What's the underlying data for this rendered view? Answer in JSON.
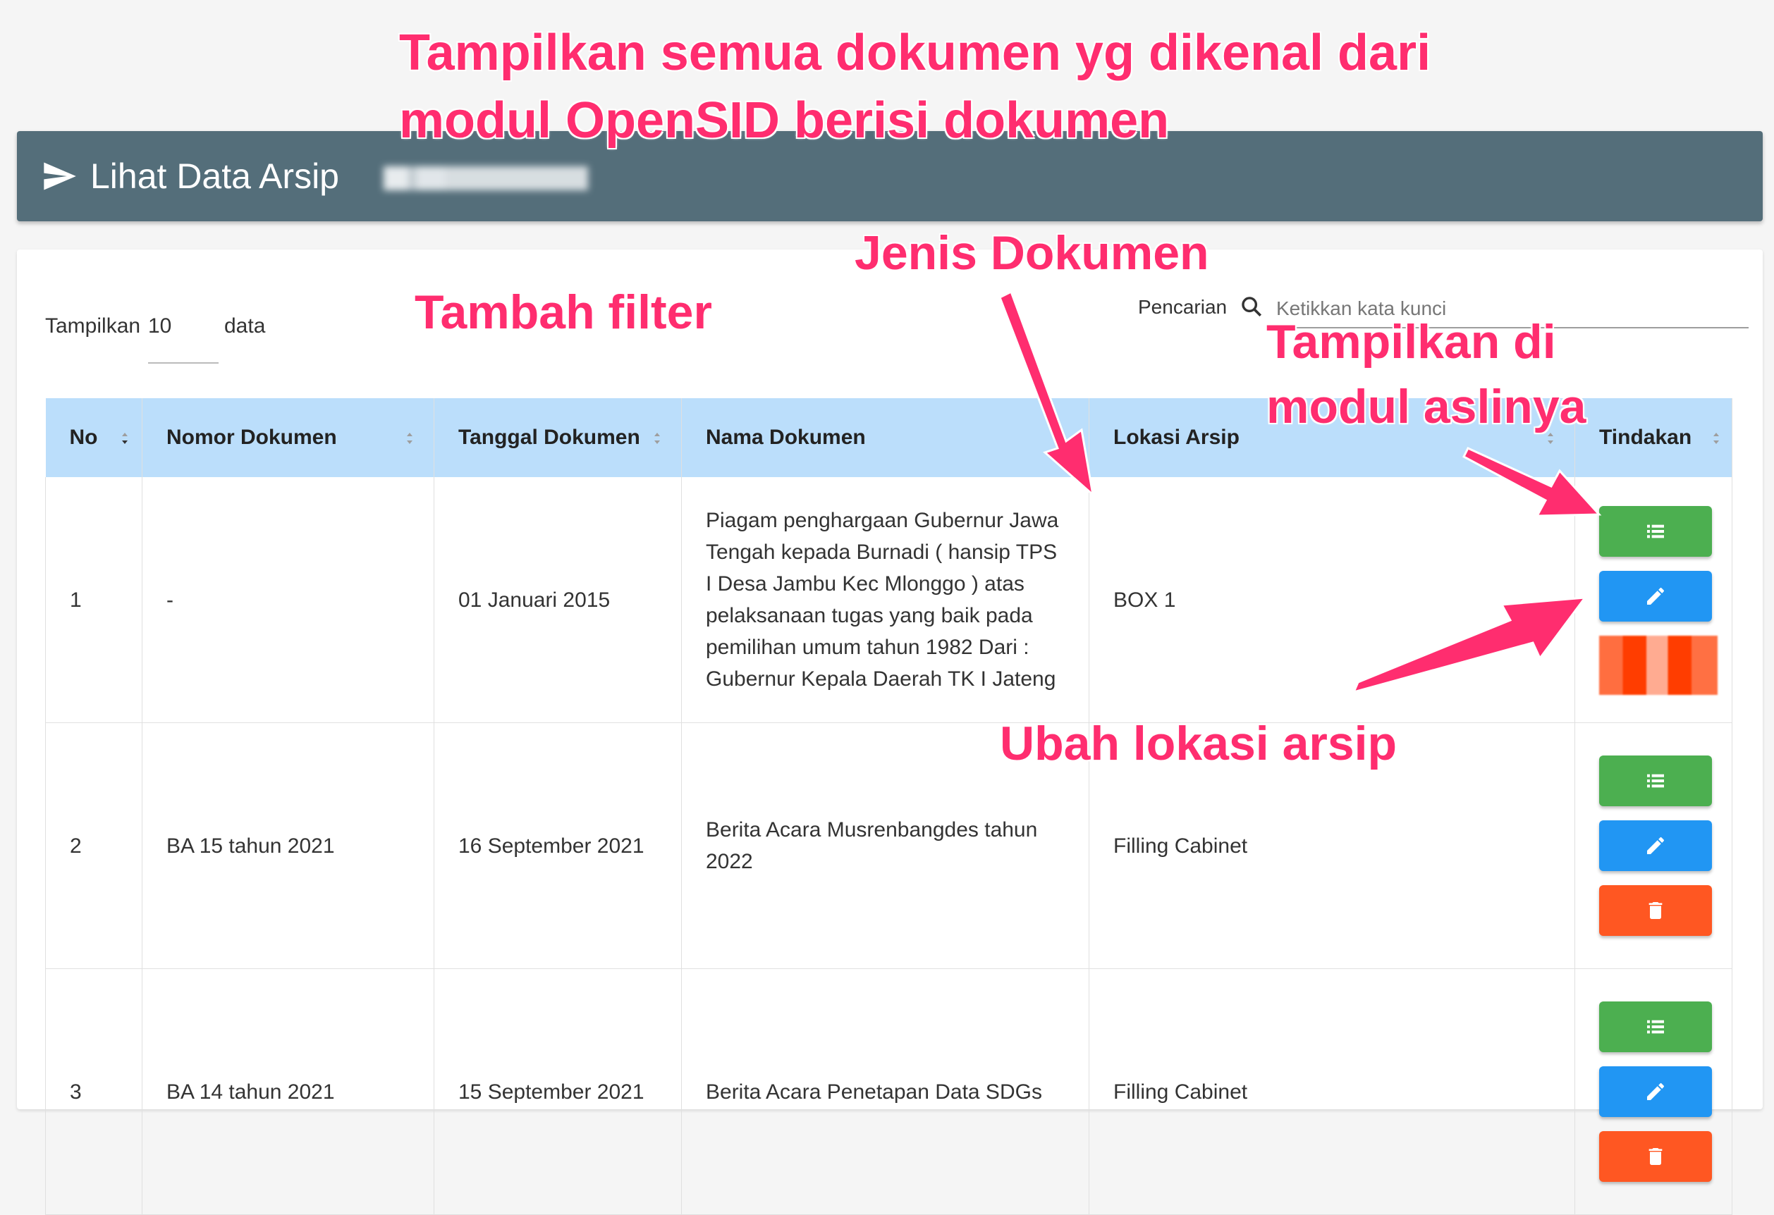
{
  "header": {
    "title": "Lihat Data Arsip",
    "icon": "send-icon",
    "color": "#546e7a"
  },
  "controls": {
    "show_label": "Tampilkan",
    "show_value": "10",
    "show_suffix": "data",
    "search_label": "Pencarian",
    "search_placeholder": "Ketikkan kata kunci"
  },
  "table": {
    "headers": [
      "No",
      "Nomor Dokumen",
      "Tanggal Dokumen",
      "Nama Dokumen",
      "Lokasi Arsip",
      "Tindakan"
    ],
    "header_color": "#bbdefb",
    "rows": [
      {
        "no": "1",
        "nomor": "-",
        "tanggal": "01 Januari 2015",
        "nama": "Piagam penghargaan Gubernur Jawa Tengah kepada Burnadi ( hansip TPS I Desa Jambu Kec Mlonggo ) atas pelaksanaan tugas yang baik pada pemilihan umum tahun 1982 Dari : Gubernur Kepala Daerah TK I Jateng",
        "lokasi": "BOX 1"
      },
      {
        "no": "2",
        "nomor": "BA 15 tahun 2021",
        "tanggal": "16 September 2021",
        "nama": "Berita Acara Musrenbangdes tahun 2022",
        "lokasi": "Filling Cabinet"
      },
      {
        "no": "3",
        "nomor": "BA 14 tahun 2021",
        "tanggal": "15 September 2021",
        "nama": "Berita Acara Penetapan Data SDGs",
        "lokasi": "Filling Cabinet"
      }
    ]
  },
  "actions": {
    "view_color": "#4caf50",
    "edit_color": "#2196f3",
    "delete_color": "#ff5722"
  },
  "annotations": {
    "top_line1": "Tampilkan semua dokumen yg dikenal dari",
    "top_line2": "modul OpenSID berisi dokumen",
    "jenis": "Jenis Dokumen",
    "filter": "Tambah filter",
    "tampilkan_line1": "Tampilkan di",
    "tampilkan_line2": "modul aslinya",
    "ubah": "Ubah lokasi arsip",
    "color": "#ff2d6f"
  }
}
